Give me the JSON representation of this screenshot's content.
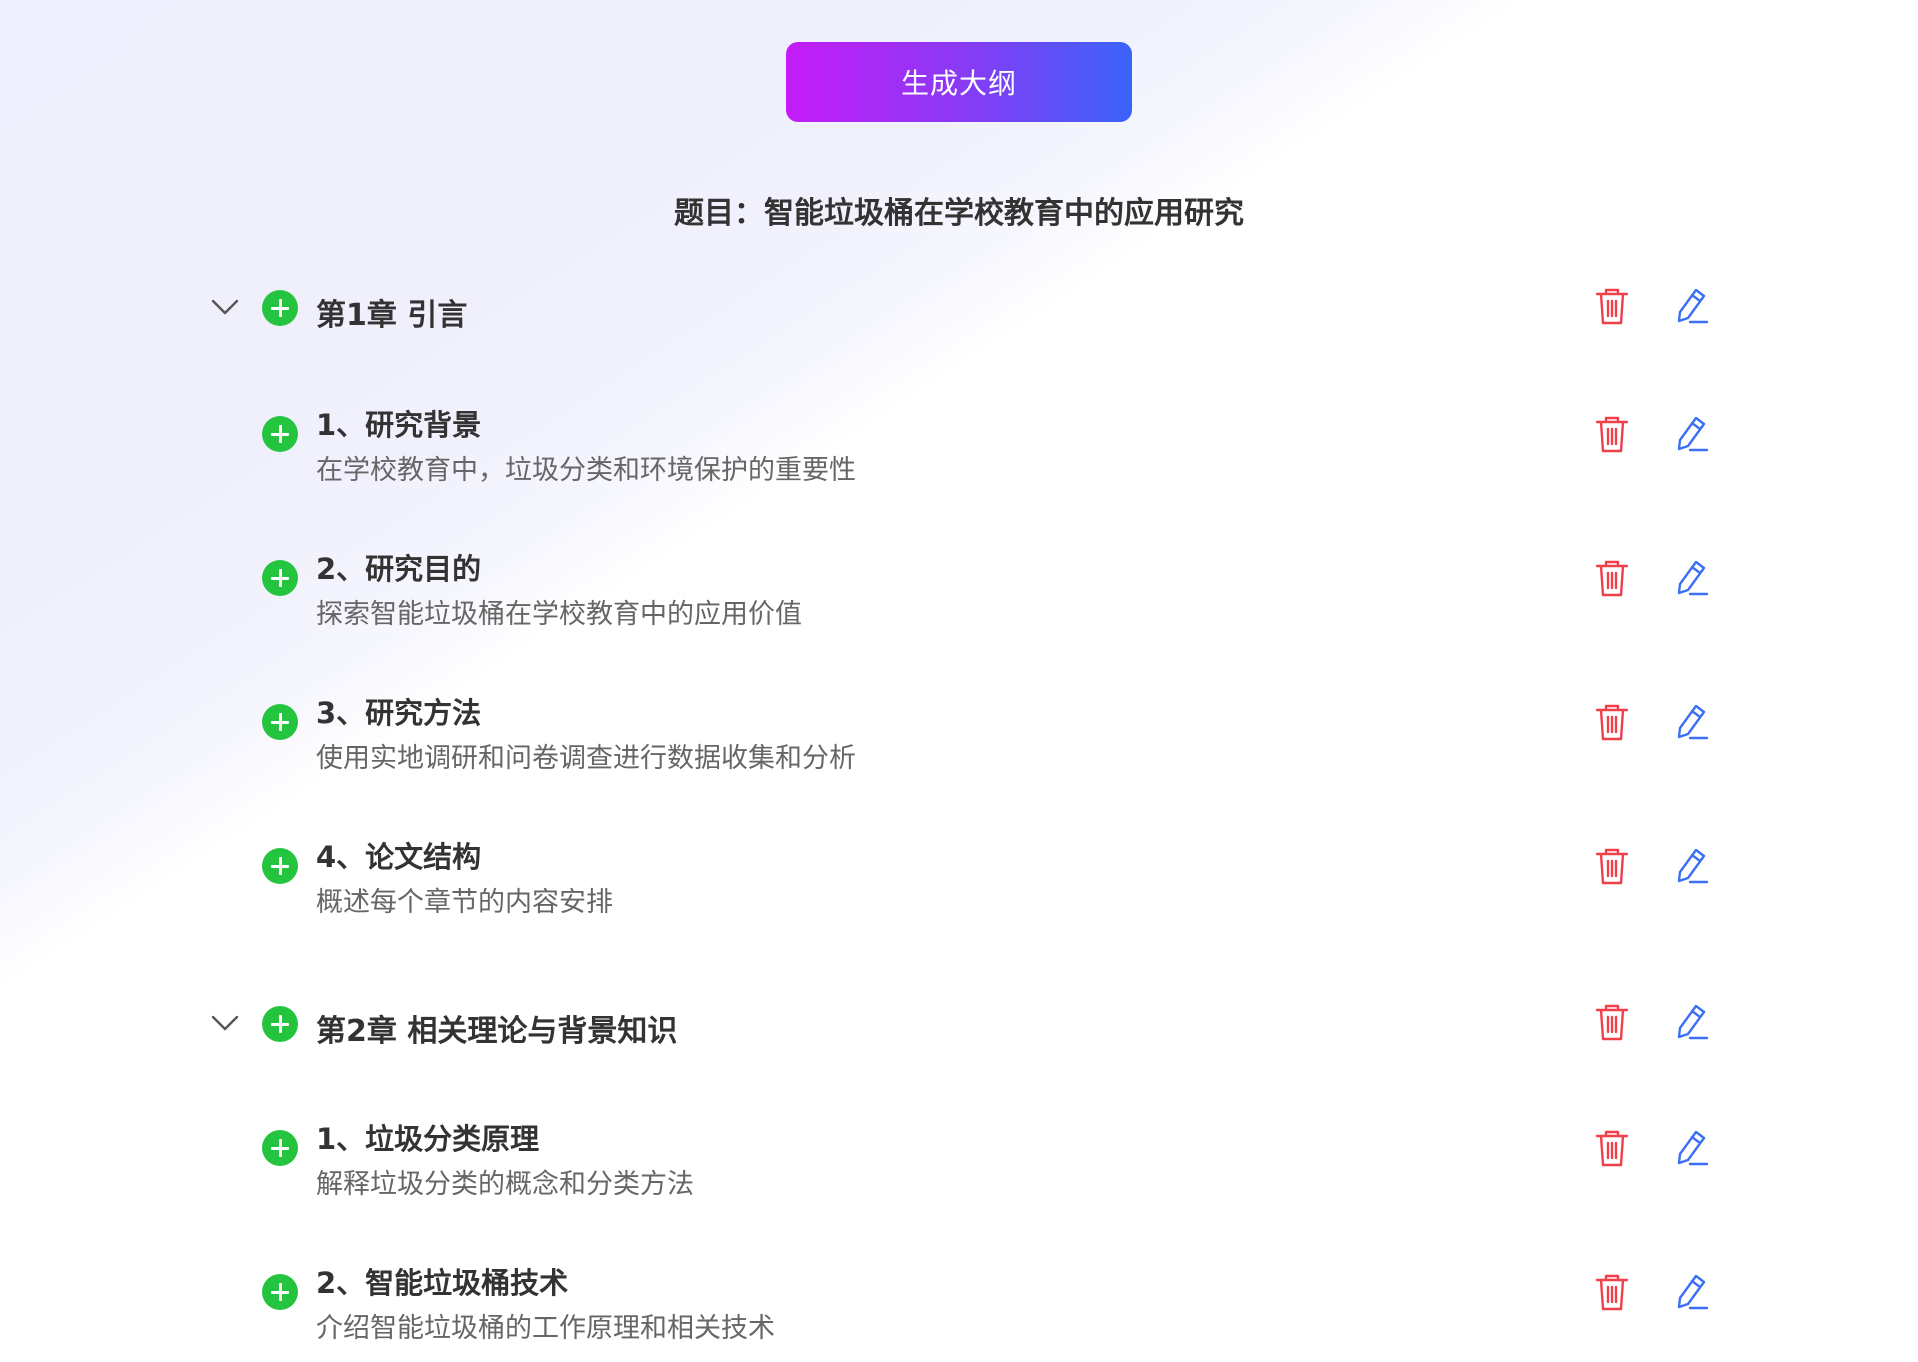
{
  "generate_button": {
    "label": "生成大纲"
  },
  "topic": {
    "title": "题目：智能垃圾桶在学校教育中的应用研究"
  },
  "chapters": [
    {
      "title": "第1章 引言",
      "sections": [
        {
          "title": "1、研究背景",
          "description": "在学校教育中，垃圾分类和环境保护的重要性"
        },
        {
          "title": "2、研究目的",
          "description": "探索智能垃圾桶在学校教育中的应用价值"
        },
        {
          "title": "3、研究方法",
          "description": "使用实地调研和问卷调查进行数据收集和分析"
        },
        {
          "title": "4、论文结构",
          "description": "概述每个章节的内容安排"
        }
      ]
    },
    {
      "title": "第2章 相关理论与背景知识",
      "sections": [
        {
          "title": "1、垃圾分类原理",
          "description": "解释垃圾分类的概念和分类方法"
        },
        {
          "title": "2、智能垃圾桶技术",
          "description": "介绍智能垃圾桶的工作原理和相关技术"
        }
      ]
    }
  ],
  "icons": {
    "expand": "chevron-down-icon",
    "add": "plus-circle-icon",
    "delete": "trash-icon",
    "edit": "pencil-icon"
  },
  "colors": {
    "add_green": "#25c43f",
    "delete_red": "#f0414b",
    "edit_blue": "#3b6ff5",
    "button_gradient_start": "#c41cf6",
    "button_gradient_end": "#3a63f9"
  }
}
